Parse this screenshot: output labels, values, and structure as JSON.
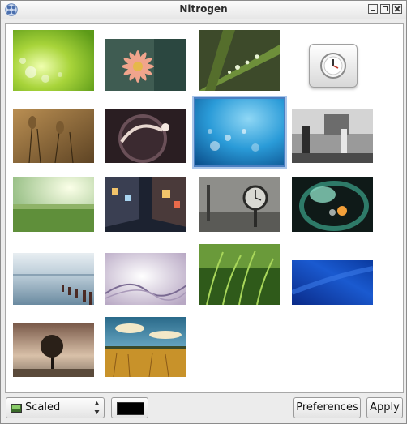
{
  "window": {
    "title": "Nitrogen",
    "icon": "nitrogen-app-icon"
  },
  "titlebar_buttons": [
    "minimize-icon",
    "maximize-icon",
    "close-icon"
  ],
  "wallpapers": [
    {
      "name": "green-bokeh-wallpaper"
    },
    {
      "name": "pink-flower-wallpaper"
    },
    {
      "name": "grass-dewdrops-wallpaper"
    },
    {
      "name": "clock-app-icon"
    },
    {
      "name": "dry-grass-wallpaper"
    },
    {
      "name": "bubble-macro-wallpaper"
    },
    {
      "name": "blue-bokeh-wallpaper",
      "selected": true
    },
    {
      "name": "bw-street-photo-wallpaper"
    },
    {
      "name": "green-meadow-sunlight-wallpaper"
    },
    {
      "name": "night-street-wallpaper"
    },
    {
      "name": "street-clock-wallpaper"
    },
    {
      "name": "teal-ring-abstract-wallpaper"
    },
    {
      "name": "sea-pier-posts-wallpaper"
    },
    {
      "name": "white-purple-swirl-wallpaper"
    },
    {
      "name": "green-grass-blades-wallpaper"
    },
    {
      "name": "blue-gradient-wallpaper"
    },
    {
      "name": "lone-tree-wallpaper"
    },
    {
      "name": "wheat-field-sky-wallpaper"
    }
  ],
  "bottom_bar": {
    "mode_value": "Scaled",
    "mode_icon": "display-icon",
    "background_color": "#000000",
    "preferences_label": "Preferences",
    "apply_label": "Apply"
  },
  "colors": {
    "selection": "#4a7fc1",
    "window_bg": "#ececec"
  }
}
